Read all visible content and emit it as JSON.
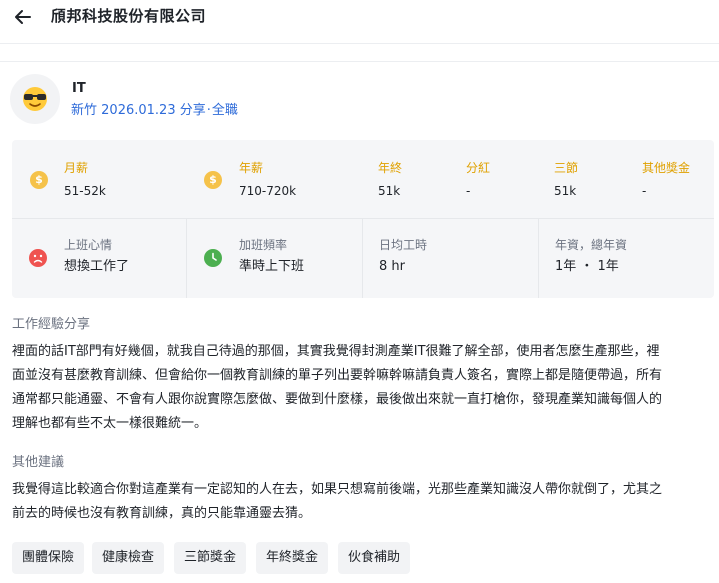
{
  "header": {
    "company_name": "頎邦科技股份有限公司",
    "back_icon": "arrow-left-icon"
  },
  "post": {
    "avatar_icon": "sunglasses-face-icon",
    "job_title": "IT",
    "location": "新竹",
    "date": "2026.01.23",
    "type": "分享",
    "employment": "全職"
  },
  "compensation": {
    "monthly_label": "月薪",
    "monthly_value": "51-52k",
    "annual_label": "年薪",
    "annual_value": "710-720k",
    "yearend_label": "年終",
    "yearend_value": "51k",
    "dividend_label": "分紅",
    "dividend_value": "-",
    "festival_label": "三節",
    "festival_value": "51k",
    "other_bonus_label": "其他獎金",
    "other_bonus_value": "-"
  },
  "work": {
    "mood_label": "上班心情",
    "mood_value": "想換工作了",
    "overtime_label": "加班頻率",
    "overtime_value": "準時上下班",
    "hours_label": "日均工時",
    "hours_value": "8 hr",
    "seniority_label": "年資，總年資",
    "seniority_value": "1年 ・ 1年"
  },
  "experience": {
    "heading": "工作經驗分享",
    "line1": "裡面的話IT部門有好幾個，就我自己待過的那個，其實我覺得封測產業IT很難了解全部，使用者怎麼生產那些，裡",
    "line2": "面並沒有甚麼教育訓練、但會給你一個教育訓練的單子列出要幹嘛幹嘛請負責人簽名，實際上都是隨便帶過，所有",
    "line3": "通常都只能通靈、不會有人跟你說實際怎麼做、要做到什麼樣，最後做出來就一直打槍你，發現產業知識每個人的",
    "line4": "理解也都有些不太一樣很難統一。"
  },
  "suggestion": {
    "heading": "其他建議",
    "line1": "我覺得這比較適合你對這產業有一定認知的人在去，如果只想寫前後端，光那些產業知識沒人帶你就倒了，尤其之",
    "line2": "前去的時候也沒有教育訓練，真的只能靠通靈去猜。"
  },
  "tags": [
    "團體保險",
    "健康檢查",
    "三節獎金",
    "年終獎金",
    "伙食補助"
  ],
  "colors": {
    "accent_blue": "#2e6bd9",
    "money_label": "#e0a100",
    "coin": "#f5c24a",
    "sad_face": "#ef5350",
    "clock": "#4caf50"
  }
}
